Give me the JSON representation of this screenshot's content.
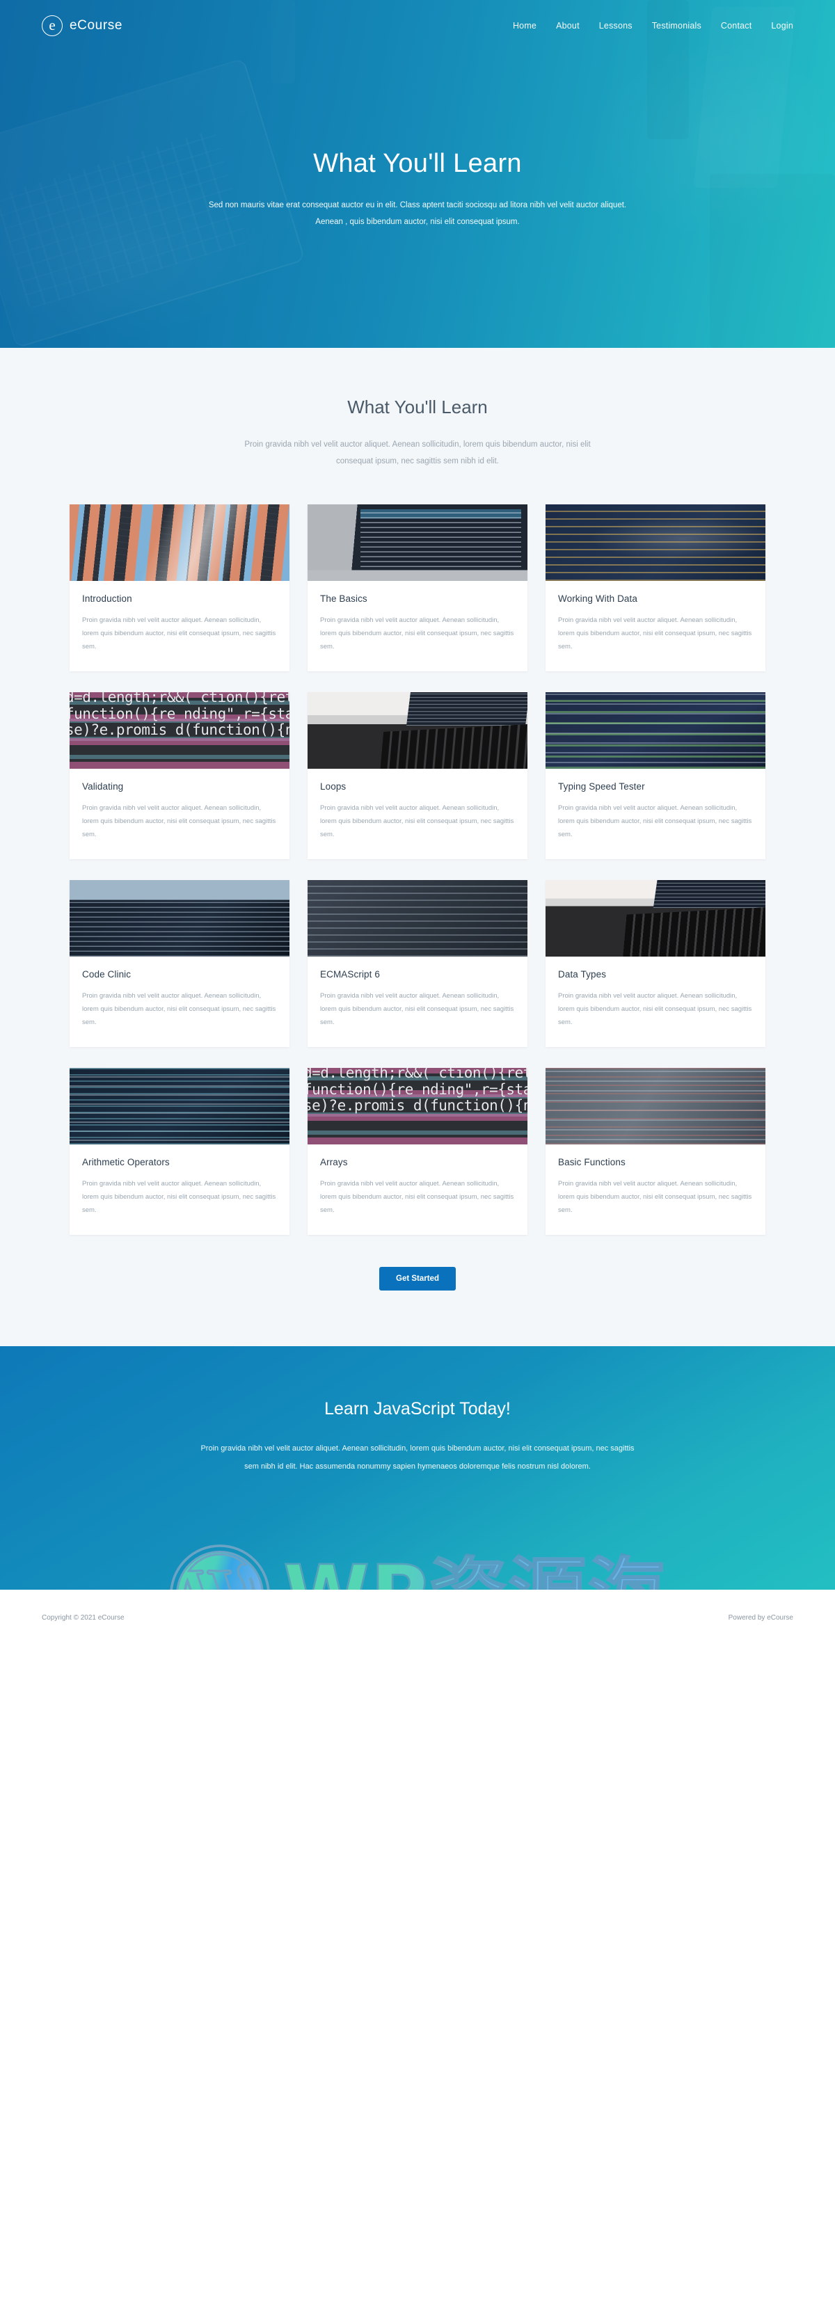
{
  "brand": {
    "mark": "logo-e-icon",
    "name": "eCourse"
  },
  "nav": {
    "links": [
      {
        "label": "Home"
      },
      {
        "label": "About"
      },
      {
        "label": "Lessons"
      },
      {
        "label": "Testimonials"
      },
      {
        "label": "Contact"
      },
      {
        "label": "Login"
      }
    ]
  },
  "hero": {
    "title": "What You'll Learn",
    "line1": "Sed non mauris vitae erat consequat auctor eu in elit. Class aptent taciti sociosqu ad litora nibh vel velit auctor aliquet.",
    "line2": "Aenean , quis bibendum auctor, nisi elit consequat ipsum."
  },
  "section": {
    "title": "What You'll Learn",
    "subtitle": "Proin gravida nibh vel velit auctor aliquet. Aenean sollicitudin, lorem quis bibendum auctor, nisi elit consequat ipsum, nec sagittis sem nibh id elit.",
    "card_text": "Proin gravida nibh vel velit auctor aliquet. Aenean sollicitudin, lorem quis bibendum auctor, nisi elit consequat ipsum, nec sagittis sem.",
    "cards": [
      {
        "title": "Introduction",
        "image": "code-dark-blur"
      },
      {
        "title": "The Basics",
        "image": "laptop-editor"
      },
      {
        "title": "Working With Data",
        "image": "navy-code-screen"
      },
      {
        "title": "Validating",
        "image": "pink-code-closeup"
      },
      {
        "title": "Loops",
        "image": "macbook-desk"
      },
      {
        "title": "Typing Speed Tester",
        "image": "blue-code-screen"
      },
      {
        "title": "Code Clinic",
        "image": "dark-monitor-code"
      },
      {
        "title": "ECMAScript 6",
        "image": "dim-code-screen"
      },
      {
        "title": "Data Types",
        "image": "macbook-desk-2"
      },
      {
        "title": "Arithmetic Operators",
        "image": "teal-code-screen"
      },
      {
        "title": "Arrays",
        "image": "pink-code-closeup"
      },
      {
        "title": "Basic Functions",
        "image": "grey-code-screen"
      }
    ],
    "button": "Get Started"
  },
  "cta": {
    "title": "Learn JavaScript Today!",
    "text": "Proin gravida nibh vel velit auctor aliquet. Aenean sollicitudin, lorem quis bibendum auctor, nisi elit consequat ipsum, nec sagittis sem nibh id elit. Hac assumenda nonummy sapien hymenaeos doloremque felis nostrum nisl dolorem."
  },
  "footer": {
    "copyright": "Copyright © 2021 eCourse",
    "powered": "Powered by eCourse"
  },
  "watermark": {
    "text": "WP资源海",
    "logo": "wordpress-logo-icon"
  },
  "colors": {
    "brand_blue": "#0a72bd",
    "hero_start": "#1577b0",
    "hero_end": "#25bcc4",
    "section_bg": "#f4f7f9",
    "title_text": "#2d3e50",
    "muted_text": "#9aa6b1"
  }
}
